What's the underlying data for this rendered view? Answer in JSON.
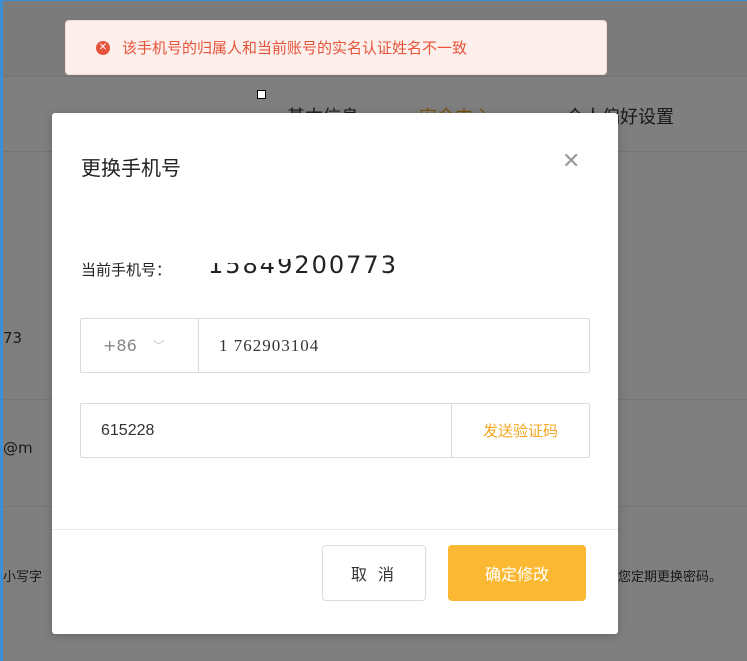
{
  "background": {
    "tabs": [
      "基本信息",
      "安全中心",
      "个人偏好设置"
    ],
    "fragments": {
      "row1": "73",
      "row2": "@m",
      "row3_left": "小写字",
      "row3_right": "您定期更换密码。"
    }
  },
  "toast": {
    "icon": "close-circle-icon",
    "message": "该手机号的归属人和当前账号的实名认证姓名不一致"
  },
  "modal": {
    "title": "更换手机号",
    "close_icon": "close-icon",
    "current_label": "当前手机号：",
    "current_value": "15849200773",
    "country_code": "+86",
    "phone_value": "1 762903104",
    "code_value": "615228",
    "send_code_label": "发送验证码",
    "cancel_label": "取 消",
    "confirm_label": "确定修改"
  },
  "colors": {
    "accent": "#f5a623",
    "confirm_button": "#fbb933",
    "error": "#e5553c",
    "toast_bg": "#fdefeb"
  }
}
